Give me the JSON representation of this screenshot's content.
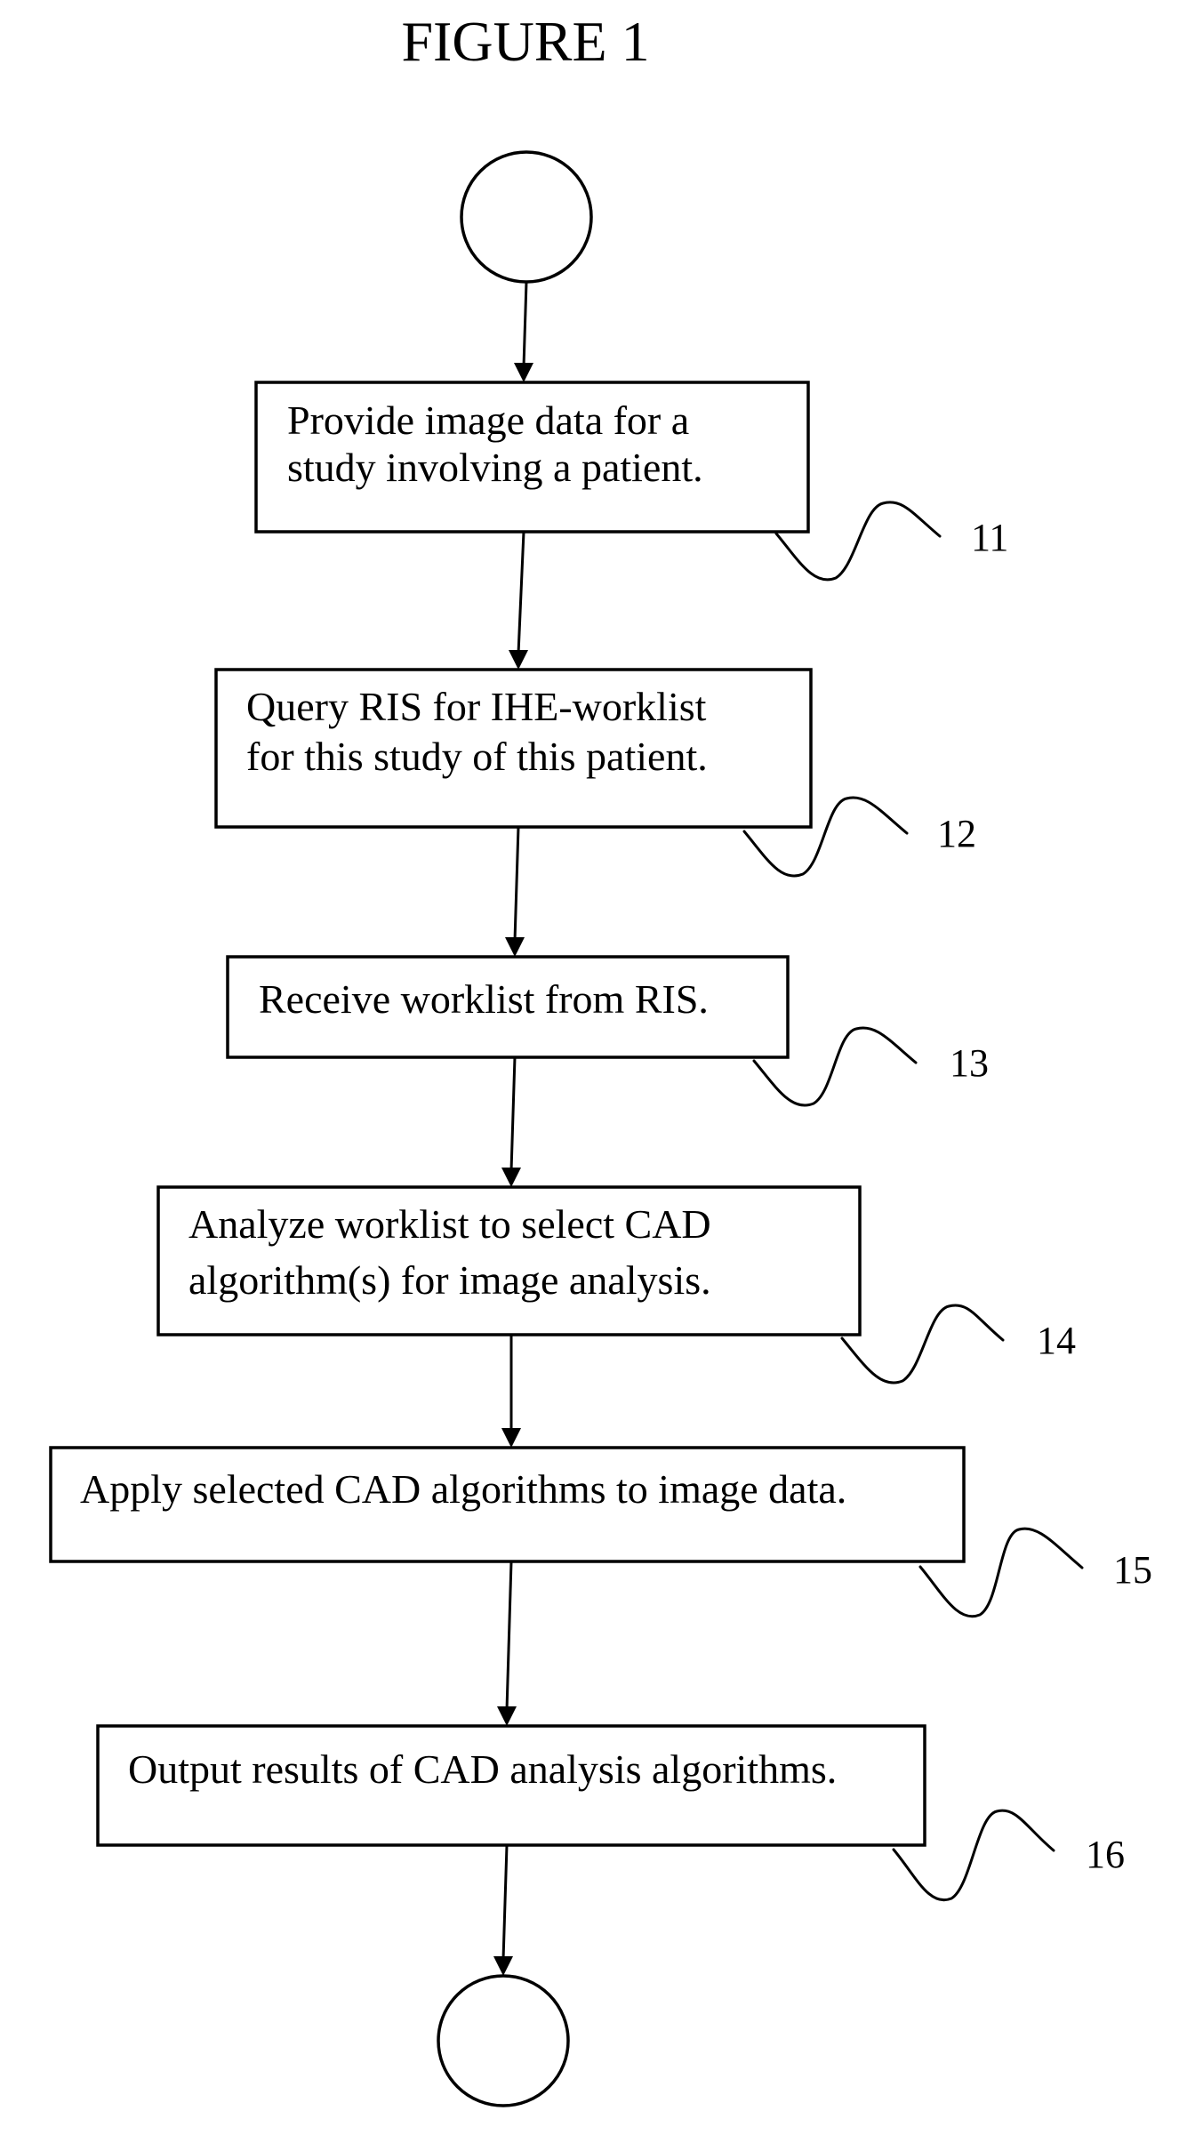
{
  "figure": {
    "title": "FIGURE 1",
    "type": "flowchart",
    "start_terminal": {
      "shape": "circle",
      "label": ""
    },
    "end_terminal": {
      "shape": "circle",
      "label": ""
    },
    "steps": [
      {
        "ref": "11",
        "lines": [
          "Provide image data for a",
          "study involving a patient."
        ]
      },
      {
        "ref": "12",
        "lines": [
          "Query RIS for IHE-worklist",
          "for this study of this patient."
        ]
      },
      {
        "ref": "13",
        "lines": [
          "Receive worklist from RIS."
        ]
      },
      {
        "ref": "14",
        "lines": [
          "Analyze worklist to select CAD",
          "algorithm(s) for image analysis."
        ]
      },
      {
        "ref": "15",
        "lines": [
          "Apply selected CAD algorithms to image data."
        ]
      },
      {
        "ref": "16",
        "lines": [
          "Output results of CAD analysis algorithms."
        ]
      }
    ],
    "flow": [
      "start",
      "11",
      "12",
      "13",
      "14",
      "15",
      "16",
      "end"
    ],
    "colors": {
      "ink": "#000000",
      "paper": "#ffffff"
    }
  }
}
